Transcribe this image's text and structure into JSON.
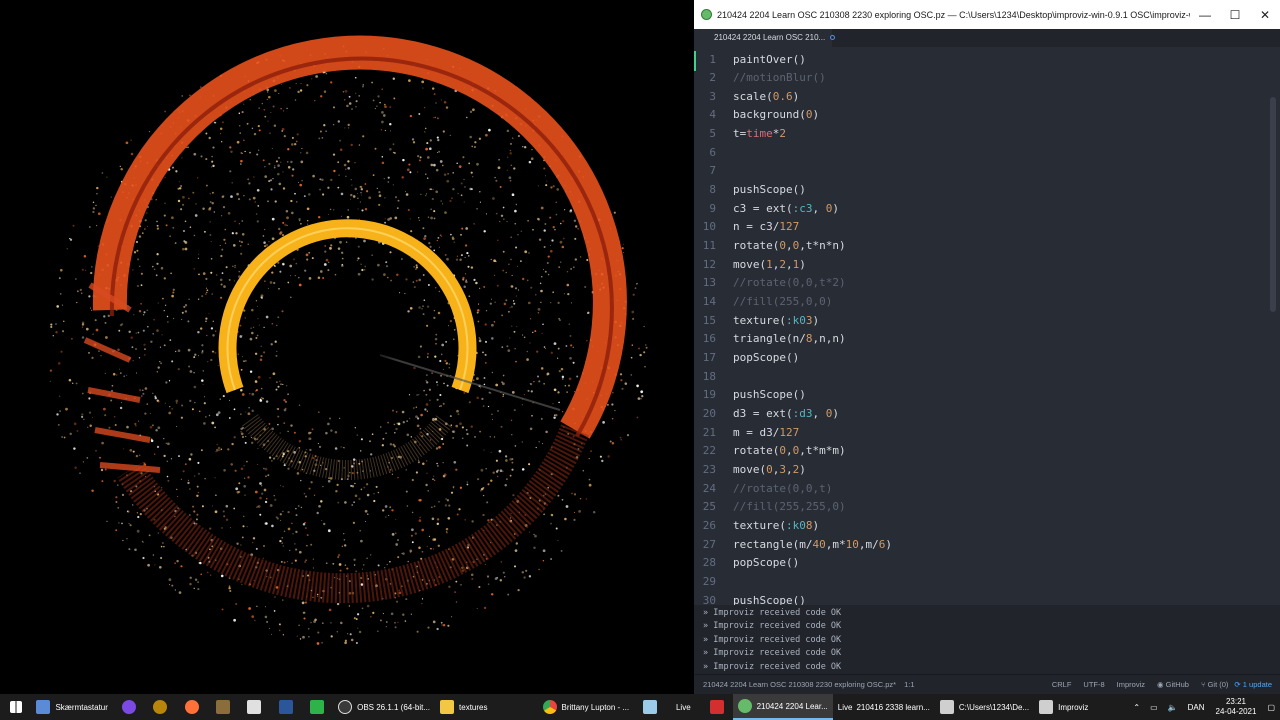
{
  "window": {
    "title": "210424 2204 Learn OSC 210308 2230 exploring OSC.pz — C:\\Users\\1234\\Desktop\\improviz-win-0.9.1 OSC\\improviz-win — Atom",
    "minimize_icon": "—",
    "maximize_icon": "☐",
    "close_icon": "✕"
  },
  "tab": {
    "label": "210424 2204 Learn OSC 210..."
  },
  "editor": {
    "lines": [
      {
        "n": "1",
        "text": "paintOver()"
      },
      {
        "n": "2",
        "text": "//motionBlur()"
      },
      {
        "n": "3",
        "text": "scale(0.6)"
      },
      {
        "n": "4",
        "text": "background(0)"
      },
      {
        "n": "5",
        "text": "t=time*2"
      },
      {
        "n": "6",
        "text": ""
      },
      {
        "n": "7",
        "text": ""
      },
      {
        "n": "8",
        "text": "pushScope()"
      },
      {
        "n": "9",
        "text": "c3 = ext(:c3, 0)"
      },
      {
        "n": "10",
        "text": "n = c3/127"
      },
      {
        "n": "11",
        "text": "rotate(0,0,t*n*n)"
      },
      {
        "n": "12",
        "text": "move(1,2,1)"
      },
      {
        "n": "13",
        "text": "//rotate(0,0,t*2)"
      },
      {
        "n": "14",
        "text": "//fill(255,0,0)"
      },
      {
        "n": "15",
        "text": "texture(:k03)"
      },
      {
        "n": "16",
        "text": "triangle(n/8,n,n)"
      },
      {
        "n": "17",
        "text": "popScope()"
      },
      {
        "n": "18",
        "text": ""
      },
      {
        "n": "19",
        "text": "pushScope()"
      },
      {
        "n": "20",
        "text": "d3 = ext(:d3, 0)"
      },
      {
        "n": "21",
        "text": "m = d3/127"
      },
      {
        "n": "22",
        "text": "rotate(0,0,t*m*m)"
      },
      {
        "n": "23",
        "text": "move(0,3,2)"
      },
      {
        "n": "24",
        "text": "//rotate(0,0,t)"
      },
      {
        "n": "25",
        "text": "//fill(255,255,0)"
      },
      {
        "n": "26",
        "text": "texture(:k08)"
      },
      {
        "n": "27",
        "text": "rectangle(m/40,m*10,m/6)"
      },
      {
        "n": "28",
        "text": "popScope()"
      },
      {
        "n": "29",
        "text": ""
      },
      {
        "n": "30",
        "text": "pushScope()"
      }
    ]
  },
  "console": {
    "lines": [
      "» Improviz received code OK",
      "» Improviz received code OK",
      "» Improviz received code OK",
      "» Improviz received code OK",
      "» Improviz received code OK"
    ]
  },
  "statusbar": {
    "file": "210424 2204 Learn OSC 210308 2230 exploring OSC.pz*",
    "cursor": "1:1",
    "line_ending": "CRLF",
    "encoding": "UTF-8",
    "grammar": "Improviz",
    "github": "GitHub",
    "git": "Git (0)",
    "update": "1 update"
  },
  "taskbar": {
    "items": [
      {
        "name": "taskbar-item-skaermtastatur",
        "label": "Skærmtastatur",
        "color": "#5b8bd6"
      },
      {
        "name": "taskbar-item-obs",
        "label": "OBS 26.1.1 (64-bit...",
        "color": "#3a3a3a"
      },
      {
        "name": "taskbar-item-textures",
        "label": "textures",
        "color": "#f2c744"
      },
      {
        "name": "taskbar-item-chrome",
        "label": "Brittany Lupton - ...",
        "color": "#e8453c"
      },
      {
        "name": "taskbar-item-live",
        "label": "Live",
        "color": "#444444"
      },
      {
        "name": "taskbar-item-atom",
        "label": "210424 2204 Lear...",
        "color": "#66bb6a"
      },
      {
        "name": "taskbar-item-live-set",
        "label": "210416 2338 learn...",
        "color": "#444444"
      },
      {
        "name": "taskbar-item-explorer",
        "label": "C:\\Users\\1234\\De...",
        "color": "#cfcfcf"
      },
      {
        "name": "taskbar-item-improviz",
        "label": "Improviz",
        "color": "#cfcfcf"
      }
    ],
    "tray_lang": "DAN",
    "time": "23:21",
    "date": "24-04-2021"
  },
  "colors": {
    "ring_outer": "#e8501c",
    "ring_inner": "#f7b21a",
    "editor_bg": "#282c34",
    "accent": "#528bff"
  }
}
